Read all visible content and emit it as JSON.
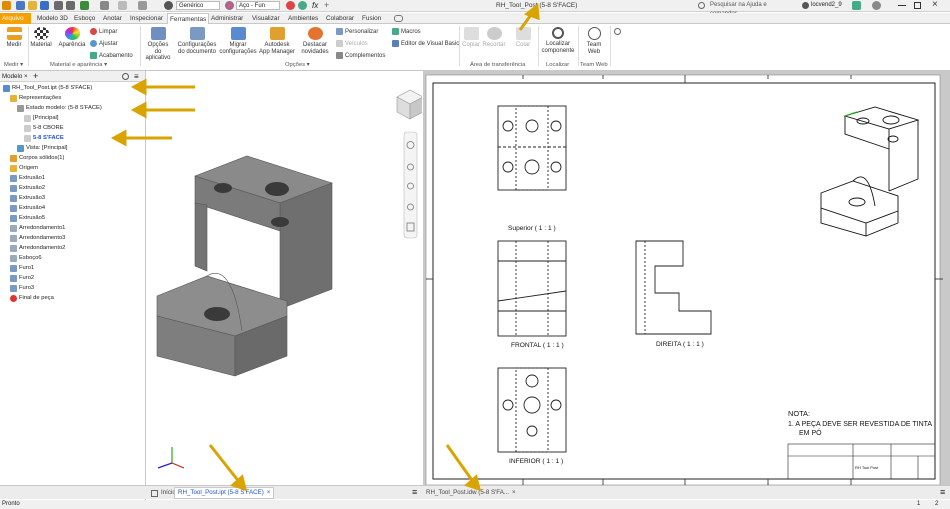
{
  "title_bar": {
    "title": "RH_Tool_Post (5-8 S'FACE)",
    "search_placeholder": "Pesquisar na Ajuda e comandos...",
    "user": "locvend2_9",
    "material": "Genérico",
    "appearance": "Aço - Fun"
  },
  "tabs": [
    "Arquivo",
    "Modelo 3D",
    "Esboço",
    "Anotar",
    "Inspecionar",
    "Ferramentas",
    "Administrar",
    "Visualizar",
    "Ambientes",
    "Colaborar",
    "Fusion"
  ],
  "ribbon": {
    "medir": "Medir",
    "material": "Material",
    "aparencia": "Aparência",
    "limpar": "Limpar",
    "ajustar": "Ajustar",
    "acabamento": "Acabamento",
    "opcoes_aplicativo": [
      "Opções",
      "do aplicativo"
    ],
    "configuracoes_documento": [
      "Configurações",
      "do documento"
    ],
    "migrar": [
      "Migrar",
      "configurações"
    ],
    "autodesk": [
      "Autodesk",
      "App Manager"
    ],
    "destacar": [
      "Destacar",
      "novidades"
    ],
    "personalizar": "Personalizar",
    "veiculos": "Veículos",
    "complementos": "Complementos",
    "macros": "Macros",
    "editor_vb": "Editor de Visual Basic",
    "copiar": "Copiar",
    "recortar": "Recortar",
    "colar": "Colar",
    "localizar": [
      "Localizar",
      "componente"
    ],
    "team_web": "Team Web",
    "groups": {
      "medir": "Medir ▾",
      "material": "Material e aparência ▾",
      "opcoes": "Opções ▾",
      "transferencia": "Área de transferência",
      "localizar": "Localizar",
      "team": "Team Web"
    }
  },
  "browser": {
    "header": "Modelo ×",
    "items": [
      {
        "label": "RH_Tool_Post.ipt (5-8 S'FACE)",
        "indent": 0
      },
      {
        "label": "Representações",
        "indent": 1
      },
      {
        "label": "Estado modelo: (5-8 S'FACE)",
        "indent": 2
      },
      {
        "label": "[Principal]",
        "indent": 3
      },
      {
        "label": "5-8 CBORE",
        "indent": 3
      },
      {
        "label": "5-8 S'FACE",
        "indent": 3
      },
      {
        "label": "Vista: [Principal]",
        "indent": 2
      },
      {
        "label": "Corpos sólidos(1)",
        "indent": 1
      },
      {
        "label": "Origem",
        "indent": 1
      },
      {
        "label": "Extrusão1",
        "indent": 1
      },
      {
        "label": "Extrusão2",
        "indent": 1
      },
      {
        "label": "Extrusão3",
        "indent": 1
      },
      {
        "label": "Extrusão4",
        "indent": 1
      },
      {
        "label": "Extrusão5",
        "indent": 1
      },
      {
        "label": "Arredondamento1",
        "indent": 1
      },
      {
        "label": "Arredondamento3",
        "indent": 1
      },
      {
        "label": "Arredondamento2",
        "indent": 1
      },
      {
        "label": "Esboço6",
        "indent": 1
      },
      {
        "label": "Furo1",
        "indent": 1
      },
      {
        "label": "Furo2",
        "indent": 1
      },
      {
        "label": "Furo3",
        "indent": 1
      },
      {
        "label": "Final de peça",
        "indent": 1
      }
    ]
  },
  "drawing": {
    "views": {
      "superior": "Superior ( 1 : 1 )",
      "frontal": "FRONTAL ( 1 : 1 )",
      "direita": "DIREITA ( 1 : 1 )",
      "inferior": "INFERIOR ( 1 : 1 )"
    },
    "note_title": "NOTA:",
    "note_1": "1.    A PEÇA DEVE SER REVESTIDA DE TINTA",
    "note_2": "EM PÓ",
    "title_block_name": "RH Tool Post"
  },
  "doc_tabs": {
    "home": "Início",
    "part": "RH_Tool_Post.ipt (5-8 S'FACE)",
    "drawing": "RH_Tool_Post.idw (5-8 S'FA..."
  },
  "status": {
    "text": "Pronto",
    "n1": "1",
    "n2": "2"
  }
}
